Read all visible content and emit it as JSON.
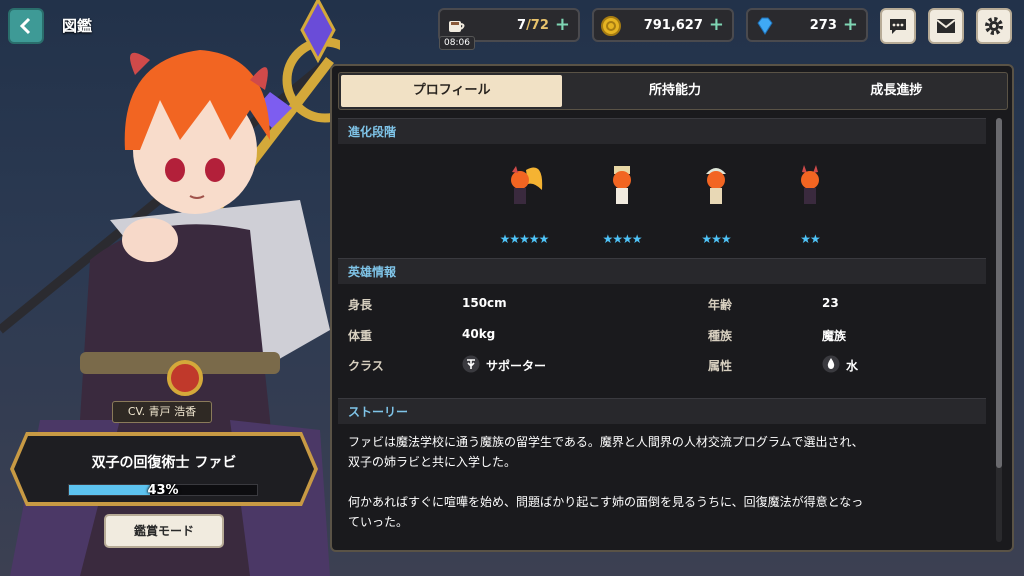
{
  "header": {
    "title": "図鑑",
    "stamina": {
      "value": "7",
      "cap": "/72",
      "timer": "08:06"
    },
    "gold": "791,627",
    "gems": "273"
  },
  "hero": {
    "cv": "CV. 青戸 浩香",
    "name": "双子の回復術士 ファビ",
    "progress": 0.43,
    "progress_text": "43%",
    "mode_button": "鑑賞モード"
  },
  "tabs": [
    {
      "label": "プロフィール"
    },
    {
      "label": "所持能力"
    },
    {
      "label": "成長進捗"
    }
  ],
  "evolution": {
    "header": "進化段階",
    "stages": [
      {
        "stars": "★★★★★"
      },
      {
        "stars": "★★★★"
      },
      {
        "stars": "★★★"
      },
      {
        "stars": "★★"
      }
    ]
  },
  "info": {
    "header": "英雄情報",
    "height_label": "身長",
    "height": "150cm",
    "age_label": "年齢",
    "age": "23",
    "weight_label": "体重",
    "weight": "40kg",
    "race_label": "種族",
    "race": "魔族",
    "class_label": "クラス",
    "class": "サポーター",
    "attr_label": "属性",
    "attr": "水"
  },
  "story": {
    "header": "ストーリー",
    "p1a": "ファビは魔法学校に通う魔族の留学生である。魔界と人間界の人材交流プログラムで選出され、",
    "p1b": "双子の姉ラビと共に入学した。",
    "p2a": "何かあればすぐに喧嘩を始め、問題ばかり起こす姉の面倒を見るうちに、回復魔法が得意となっ",
    "p2b": "ていった。"
  },
  "colors": {
    "accent_blue": "#7fc4e8",
    "star_blue": "#4fc3f7",
    "gold": "#c89a44",
    "back_teal": "#3e9a96"
  }
}
